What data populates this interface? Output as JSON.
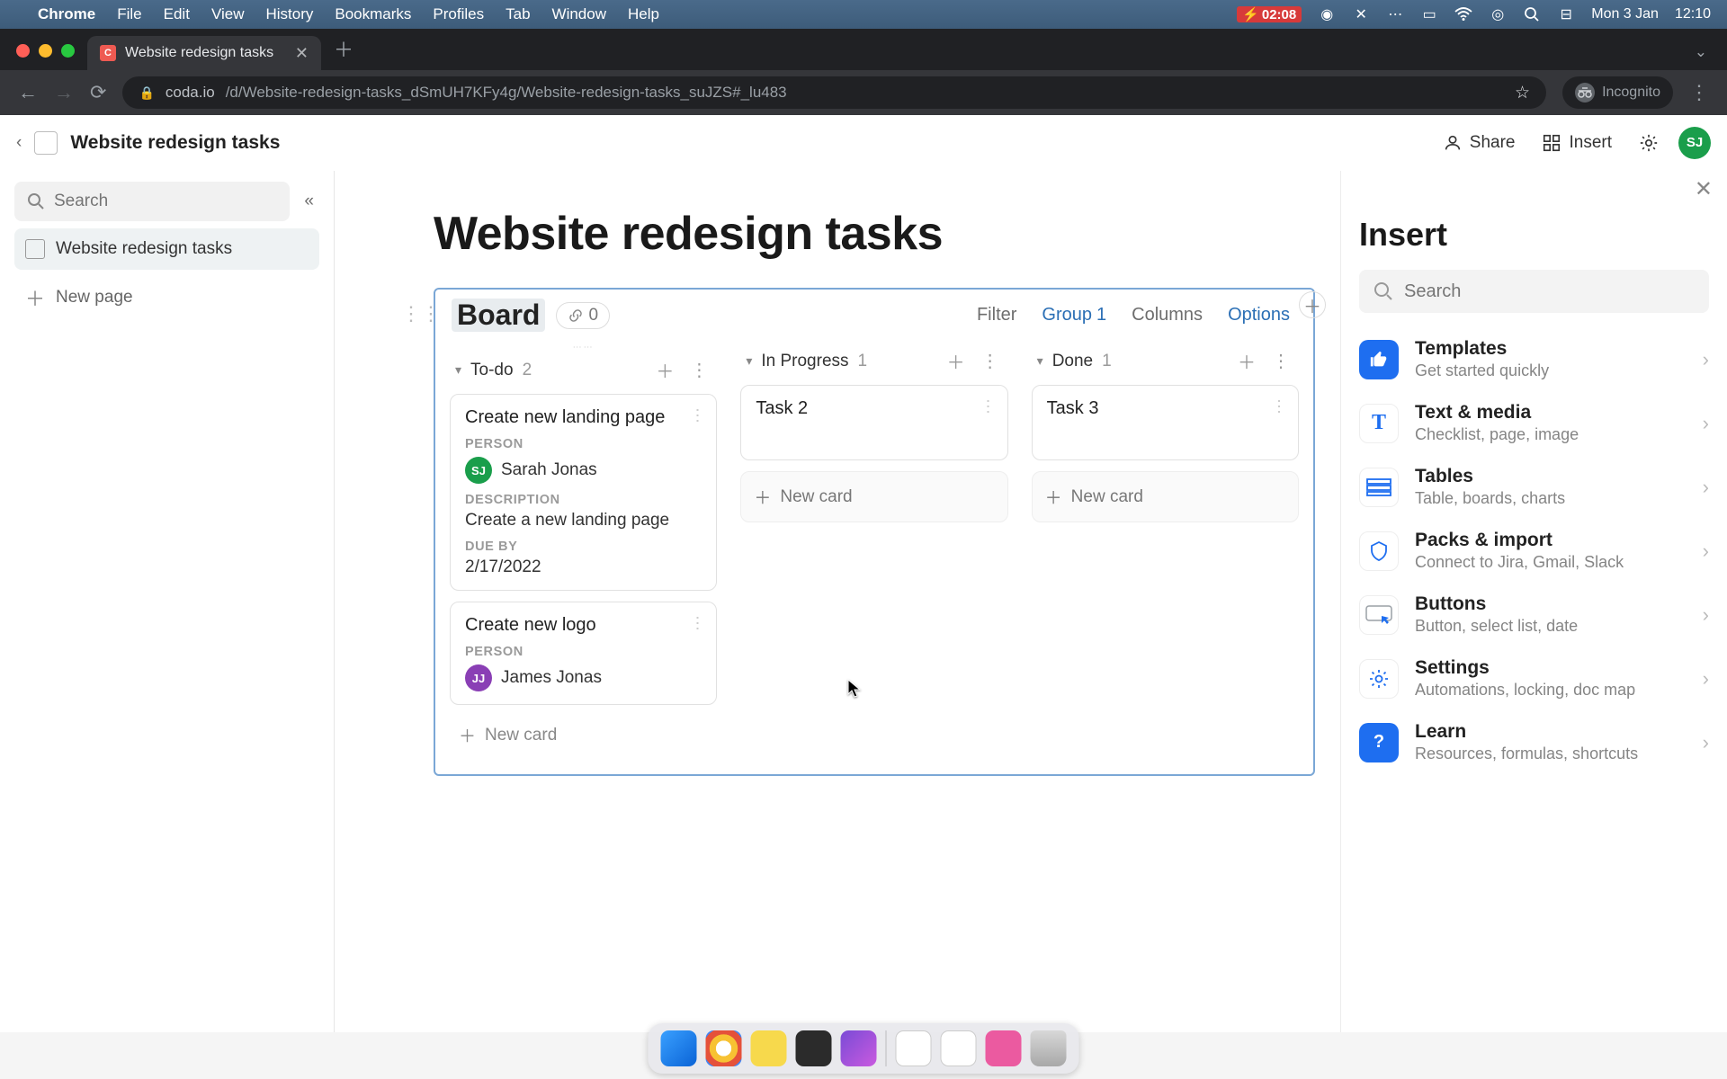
{
  "mac": {
    "app": "Chrome",
    "menus": [
      "File",
      "Edit",
      "View",
      "History",
      "Bookmarks",
      "Profiles",
      "Tab",
      "Window",
      "Help"
    ],
    "battery": "02:08",
    "date": "Mon 3 Jan",
    "time": "12:10"
  },
  "chrome": {
    "tab_title": "Website redesign tasks",
    "url_host": "coda.io",
    "url_path": "/d/Website-redesign-tasks_dSmUH7KFy4g/Website-redesign-tasks_suJZS#_lu483",
    "incognito_label": "Incognito"
  },
  "header": {
    "doc_title": "Website redesign tasks",
    "share": "Share",
    "insert": "Insert",
    "avatar_initials": "SJ"
  },
  "sidebar": {
    "search_placeholder": "Search",
    "page_item": "Website redesign tasks",
    "new_page": "New page"
  },
  "page": {
    "title": "Website redesign tasks",
    "board_label": "Board",
    "link_count": "0",
    "options": {
      "filter": "Filter",
      "group": "Group",
      "group_count": "1",
      "columns": "Columns",
      "options_label": "Options"
    }
  },
  "columns": [
    {
      "name": "To-do",
      "count": "2",
      "cards": [
        {
          "title": "Create new landing page",
          "fields": [
            {
              "label": "PERSON",
              "type": "person",
              "initials": "SJ",
              "color": "#1a9e4b",
              "name": "Sarah Jonas"
            },
            {
              "label": "DESCRIPTION",
              "type": "text",
              "value": "Create a new landing page"
            },
            {
              "label": "DUE BY",
              "type": "text",
              "value": "2/17/2022"
            }
          ]
        },
        {
          "title": "Create new logo",
          "fields": [
            {
              "label": "PERSON",
              "type": "person",
              "initials": "JJ",
              "color": "#8a3fb5",
              "name": "James Jonas"
            }
          ]
        }
      ],
      "new_card": "New card"
    },
    {
      "name": "In Progress",
      "count": "1",
      "cards": [
        {
          "title": "Task 2",
          "fields": []
        }
      ],
      "new_card": "New card"
    },
    {
      "name": "Done",
      "count": "1",
      "cards": [
        {
          "title": "Task 3",
          "fields": []
        }
      ],
      "new_card": "New card"
    }
  ],
  "insert_panel": {
    "title": "Insert",
    "search_placeholder": "Search",
    "items": [
      {
        "icon": "thumb",
        "title": "Templates",
        "sub": "Get started quickly"
      },
      {
        "icon": "T",
        "title": "Text & media",
        "sub": "Checklist, page, image"
      },
      {
        "icon": "table",
        "title": "Tables",
        "sub": "Table, boards, charts"
      },
      {
        "icon": "pack",
        "title": "Packs & import",
        "sub": "Connect to Jira, Gmail, Slack"
      },
      {
        "icon": "button",
        "title": "Buttons",
        "sub": "Button, select list, date"
      },
      {
        "icon": "gear",
        "title": "Settings",
        "sub": "Automations, locking, doc map"
      },
      {
        "icon": "help",
        "title": "Learn",
        "sub": "Resources, formulas, shortcuts"
      }
    ]
  },
  "dock_apps": [
    "finder",
    "chrome",
    "notes",
    "terminal",
    "purple",
    "calendar",
    "paper",
    "pink",
    "trash"
  ]
}
